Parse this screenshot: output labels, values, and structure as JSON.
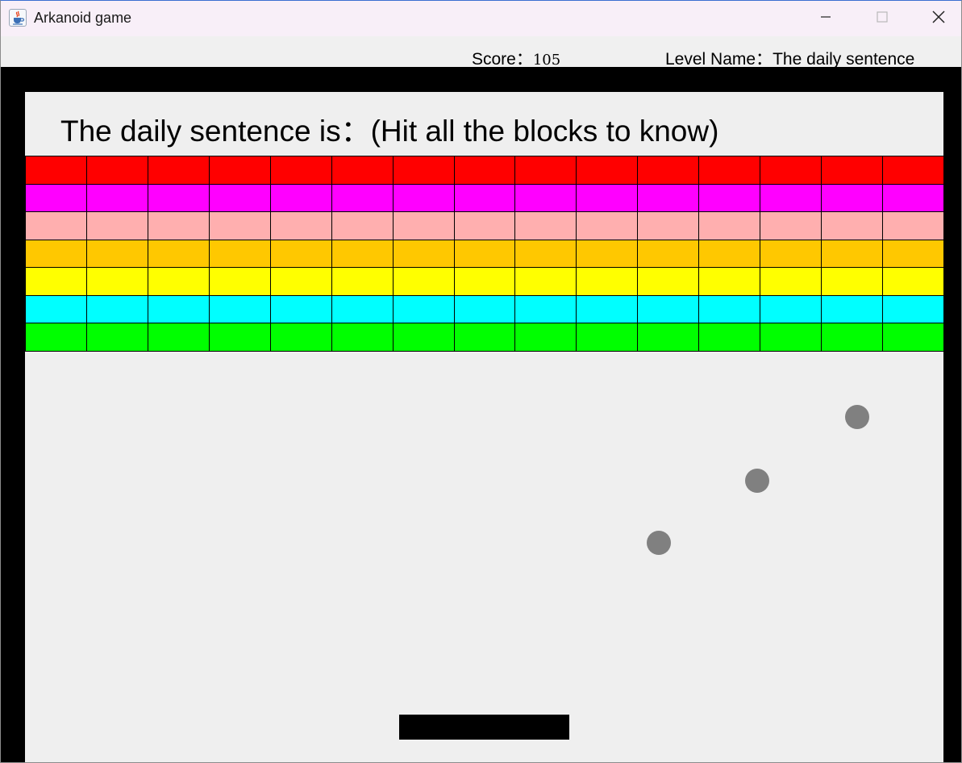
{
  "window": {
    "title": "Arkanoid game",
    "icon": "java-cup-icon",
    "controls": [
      "minimize-icon",
      "maximize-icon",
      "close-icon"
    ]
  },
  "status": {
    "score_label": "Score：",
    "score_value": "105",
    "level_label": "Level Name：",
    "level_value": "The daily sentence"
  },
  "game": {
    "sentence": "The daily sentence is：(Hit all the blocks to know)",
    "columns": 15,
    "rows": [
      {
        "name": "red",
        "color": "#ff0000"
      },
      {
        "name": "magenta",
        "color": "#ff00ff"
      },
      {
        "name": "pink",
        "color": "#ffafaf"
      },
      {
        "name": "orange",
        "color": "#ffc800"
      },
      {
        "name": "yellow",
        "color": "#ffff00"
      },
      {
        "name": "cyan",
        "color": "#00ffff"
      },
      {
        "name": "green",
        "color": "#00ff00"
      }
    ],
    "ball_color": "#808080",
    "paddle_color": "#000000",
    "frame_color": "#000000",
    "background_color": "#efefef",
    "balls": 3
  }
}
